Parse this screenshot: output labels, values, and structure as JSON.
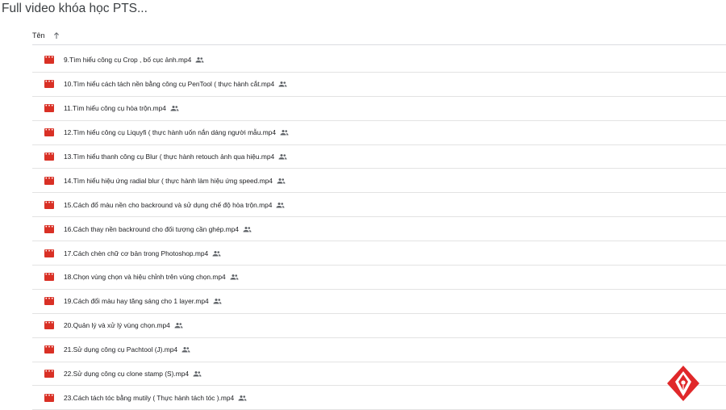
{
  "folder_title": "Full video khóa học PTS...",
  "column_header": {
    "name_label": "Tên",
    "sort_icon": "arrow-up-icon"
  },
  "colors": {
    "video_icon": "#d93025",
    "watermark": "#e0282a",
    "shared_icon": "#5f6368"
  },
  "files": [
    {
      "name": "9.Tìm hiểu công cụ Crop , bố cục ảnh.mp4",
      "shared": true
    },
    {
      "name": "10.Tìm hiểu cách tách nền bằng công cụ PenTool ( thực hành cắt.mp4",
      "shared": true
    },
    {
      "name": "11.Tìm hiểu công cụ hòa trộn.mp4",
      "shared": true
    },
    {
      "name": "12.Tìm hiểu công cụ Liquyfi ( thực hành uốn nắn dáng người mẫu.mp4",
      "shared": true
    },
    {
      "name": "13.Tìm hiểu thanh công cụ Blur ( thực hành retouch ảnh qua hiệu.mp4",
      "shared": true
    },
    {
      "name": "14.Tìm hiểu hiệu ứng radial blur ( thực hành làm hiệu ứng speed.mp4",
      "shared": true
    },
    {
      "name": "15.Cách đổ màu nền cho backround và sử dụng chế độ hòa trộn.mp4",
      "shared": true
    },
    {
      "name": "16.Cách thay nền backround cho đối tượng cần ghép.mp4",
      "shared": true
    },
    {
      "name": "17.Cách chèn chữ cơ bản trong Photoshop.mp4",
      "shared": true
    },
    {
      "name": "18.Chọn vùng chọn và hiệu chỉnh trên vùng chọn.mp4",
      "shared": true
    },
    {
      "name": "19.Cách đổi màu hay tăng sáng cho 1 layer.mp4",
      "shared": true
    },
    {
      "name": "20.Quản lý và xử lý vùng chọn.mp4",
      "shared": true
    },
    {
      "name": "21.Sử dụng công cụ Pachtool (J).mp4",
      "shared": true
    },
    {
      "name": "22.Sử dụng công cụ clone stamp (S).mp4",
      "shared": true
    },
    {
      "name": "23.Cách tách tóc bằng mutily ( Thực hành tách tóc ).mp4",
      "shared": true
    }
  ]
}
